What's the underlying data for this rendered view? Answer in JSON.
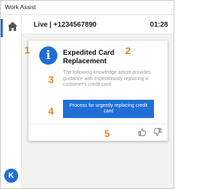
{
  "window": {
    "title": "Work Assist"
  },
  "session": {
    "id_label": "Live | +1234567890",
    "timer": "01:28"
  },
  "user": {
    "avatar_initial": "K"
  },
  "card": {
    "title": "Expedited Card Replacement",
    "description": "The following knowledge article provides guidance with expeditiously replacing a customer's credit card",
    "action_label": "Process for urgently replacing credit card"
  },
  "callouts": [
    "1",
    "2",
    "3",
    "4",
    "5"
  ],
  "colors": {
    "accent": "#1f6fd6",
    "callout": "#f07d1a"
  },
  "icons": {
    "home": "home-icon",
    "info": "info-icon",
    "thumbs_up": "thumbs-up-icon",
    "thumbs_down": "thumbs-down-icon"
  }
}
